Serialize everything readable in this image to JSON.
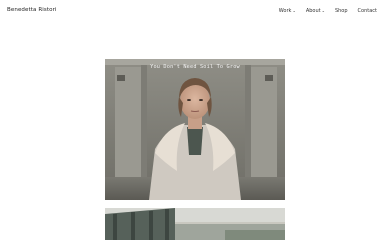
{
  "site": {
    "title": "Benedetta Ristori"
  },
  "nav": {
    "items": [
      {
        "label": "Work",
        "has_dropdown": true
      },
      {
        "label": "About",
        "has_dropdown": true
      },
      {
        "label": "Shop",
        "has_dropdown": false
      },
      {
        "label": "Contact",
        "has_dropdown": false
      }
    ],
    "dropdown_icon": "chevron-down-icon",
    "dropdown_glyph": "⌄"
  },
  "gallery": {
    "photo_1_caption": "You Don't Need Soil To Grow"
  }
}
